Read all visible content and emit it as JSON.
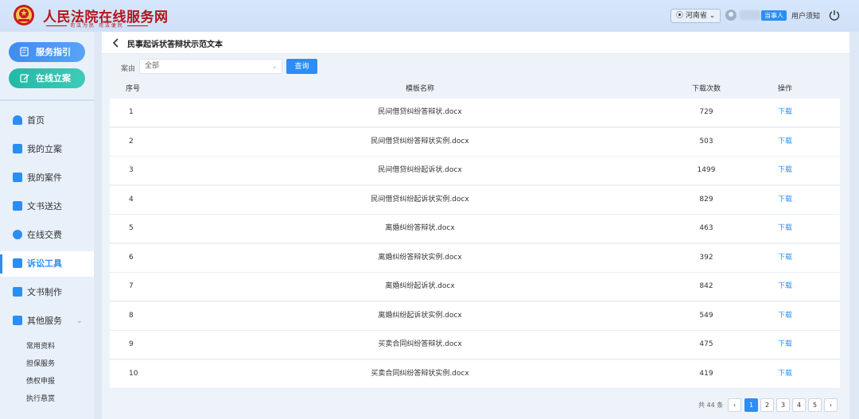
{
  "header": {
    "site_title": "人民法院在线服务网",
    "site_sub": "司法为民  司法便民",
    "region": "河南省",
    "role": "当事人",
    "notice": "用户须知"
  },
  "sidebar": {
    "guide_btn": "服务指引",
    "file_btn": "在线立案",
    "items": [
      {
        "label": "首页"
      },
      {
        "label": "我的立案"
      },
      {
        "label": "我的案件"
      },
      {
        "label": "文书送达"
      },
      {
        "label": "在线交费"
      },
      {
        "label": "诉讼工具"
      },
      {
        "label": "文书制作"
      },
      {
        "label": "其他服务"
      }
    ],
    "sub_items": [
      {
        "label": "常用资料"
      },
      {
        "label": "担保服务"
      },
      {
        "label": "债权申报"
      },
      {
        "label": "执行悬赏"
      }
    ]
  },
  "panel": {
    "title": "民事起诉状答辩状示范文本",
    "filter_label": "案由",
    "filter_value": "全部",
    "query_btn": "查询"
  },
  "table": {
    "headers": {
      "idx": "序号",
      "name": "模板名称",
      "count": "下载次数",
      "op": "操作"
    },
    "rows": [
      {
        "idx": "1",
        "name": "民间借贷纠纷答辩状.docx",
        "count": "729",
        "op": "下载"
      },
      {
        "idx": "2",
        "name": "民间借贷纠纷答辩状实例.docx",
        "count": "503",
        "op": "下载"
      },
      {
        "idx": "3",
        "name": "民间借贷纠纷起诉状.docx",
        "count": "1499",
        "op": "下载"
      },
      {
        "idx": "4",
        "name": "民间借贷纠纷起诉状实例.docx",
        "count": "829",
        "op": "下载"
      },
      {
        "idx": "5",
        "name": "离婚纠纷答辩状.docx",
        "count": "463",
        "op": "下载"
      },
      {
        "idx": "6",
        "name": "离婚纠纷答辩状实例.docx",
        "count": "392",
        "op": "下载"
      },
      {
        "idx": "7",
        "name": "离婚纠纷起诉状.docx",
        "count": "842",
        "op": "下载"
      },
      {
        "idx": "8",
        "name": "离婚纠纷起诉状实例.docx",
        "count": "549",
        "op": "下载"
      },
      {
        "idx": "9",
        "name": "买卖合同纠纷答辩状.docx",
        "count": "475",
        "op": "下载"
      },
      {
        "idx": "10",
        "name": "买卖合同纠纷答辩状实例.docx",
        "count": "419",
        "op": "下载"
      }
    ]
  },
  "pager": {
    "total": "共 44 条",
    "prev": "‹",
    "next": "›",
    "pages": [
      "1",
      "2",
      "3",
      "4",
      "5"
    ],
    "current": "1"
  },
  "colors": {
    "accent": "#2b8ef5",
    "brand_red": "#b3141b",
    "file_btn": "#22b9a6"
  }
}
